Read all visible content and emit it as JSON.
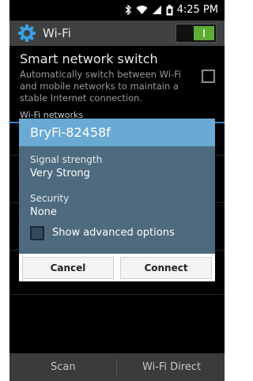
{
  "status_bar": {
    "time": "4:25 PM",
    "icons": [
      "bluetooth-icon",
      "wifi-icon",
      "signal-icon",
      "battery-icon"
    ]
  },
  "action_bar": {
    "title": "Wi-Fi",
    "icon": "gear-icon",
    "wifi_toggle": "on",
    "toggle_color": "#5dac35"
  },
  "smart_switch": {
    "title": "Smart network switch",
    "description": "Automatically switch between Wi-Fi and mobile networks to maintain a stable Internet connection.",
    "checked": false
  },
  "section_header": "Wi-Fi networks",
  "dialog": {
    "title": "BryFi-82458f",
    "signal_label": "Signal strength",
    "signal_value": "Very Strong",
    "security_label": "Security",
    "security_value": "None",
    "advanced_label": "Show advanced options",
    "advanced_checked": false,
    "cancel_label": "Cancel",
    "connect_label": "Connect",
    "accent_color": "#6aa9d3"
  },
  "bottom_bar": {
    "scan_label": "Scan",
    "direct_label": "Wi-Fi Direct"
  }
}
